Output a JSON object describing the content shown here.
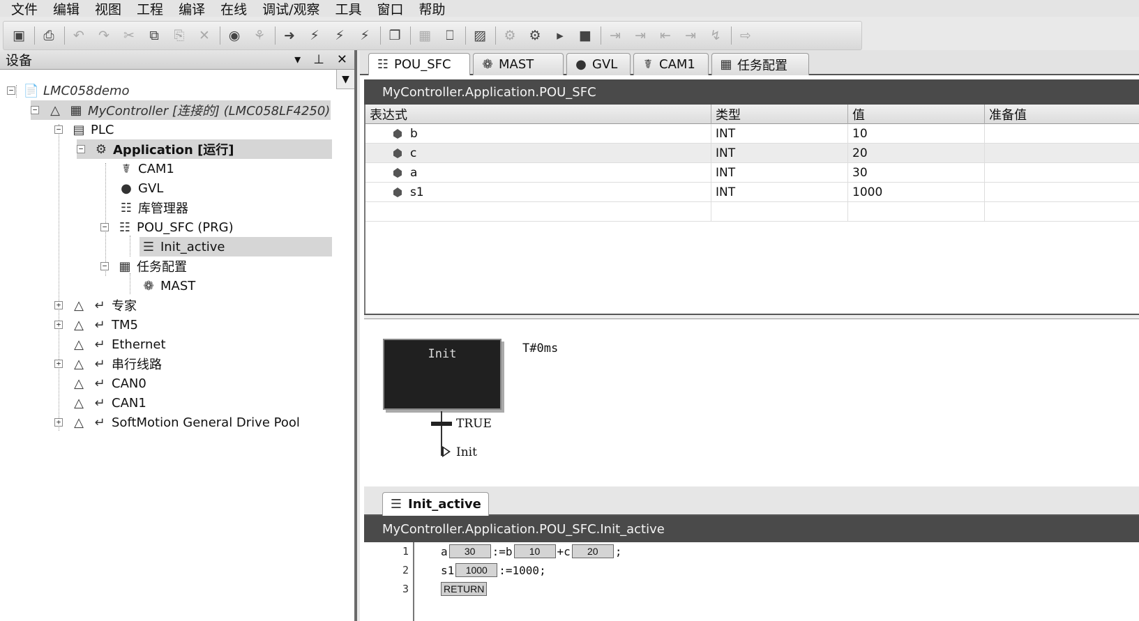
{
  "menu": [
    "文件",
    "编辑",
    "视图",
    "工程",
    "编译",
    "在线",
    "调试/观察",
    "工具",
    "窗口",
    "帮助"
  ],
  "toolbar_icons": [
    "save-icon",
    "print-icon",
    "undo-icon",
    "redo-icon",
    "cut-icon",
    "copy-icon",
    "paste-icon",
    "delete-icon",
    "find-icon",
    "find-replace-icon",
    "build-icon",
    "rebuild-icon",
    "login-icon",
    "logout-icon",
    "window-icon",
    "module-icon",
    "device-icon",
    "cam-icon",
    "debug-icon",
    "settings-icon",
    "run-icon",
    "stop-icon",
    "step-icon",
    "step-over-icon",
    "step-out-icon",
    "step-into-icon",
    "breakpoint-icon",
    "forward-icon"
  ],
  "devices": {
    "title": "设备",
    "header_icons": [
      "▾",
      "⊥",
      "✕"
    ],
    "tree": {
      "root": "LMC058demo",
      "controller": "MyController [连接的] (LMC058LF4250)",
      "plc": "PLC",
      "application": "Application [运行]",
      "cam1": "CAM1",
      "gvl": "GVL",
      "library_manager": "库管理器",
      "pou_sfc": "POU_SFC (PRG)",
      "init_active": "Init_active",
      "task_config": "任务配置",
      "mast": "MAST",
      "expert": "专家",
      "tm5": "TM5",
      "ethernet": "Ethernet",
      "serial": "串行线路",
      "can0": "CAN0",
      "can1": "CAN1",
      "softmotion": "SoftMotion General Drive Pool"
    }
  },
  "editor": {
    "tabs": [
      "POU_SFC",
      "MAST",
      "GVL",
      "CAM1",
      "任务配置"
    ],
    "title": "MyController.Application.POU_SFC",
    "watch": {
      "columns": [
        "表达式",
        "类型",
        "值",
        "准备值"
      ],
      "rows": [
        {
          "expr": "b",
          "type": "INT",
          "value": "10",
          "prepared": ""
        },
        {
          "expr": "c",
          "type": "INT",
          "value": "20",
          "prepared": ""
        },
        {
          "expr": "a",
          "type": "INT",
          "value": "30",
          "prepared": ""
        },
        {
          "expr": "s1",
          "type": "INT",
          "value": "1000",
          "prepared": ""
        }
      ]
    },
    "sfc": {
      "step_name": "Init",
      "step_time": "T#0ms",
      "transition": "TRUE",
      "jump_target": "Init"
    },
    "action_tab": "Init_active",
    "action_title": "MyController.Application.POU_SFC.Init_active",
    "code": {
      "line_numbers": [
        "1",
        "2",
        "3"
      ],
      "line1": {
        "a": "a",
        "a_val": "30",
        "assign": ":=b",
        "b_val": "10",
        "plus": "+c",
        "c_val": "20",
        "end": ";"
      },
      "line2": {
        "s1": "s1",
        "s1_val": "1000",
        "rest": ":=1000;"
      },
      "line3": {
        "return": "RETURN"
      }
    }
  }
}
